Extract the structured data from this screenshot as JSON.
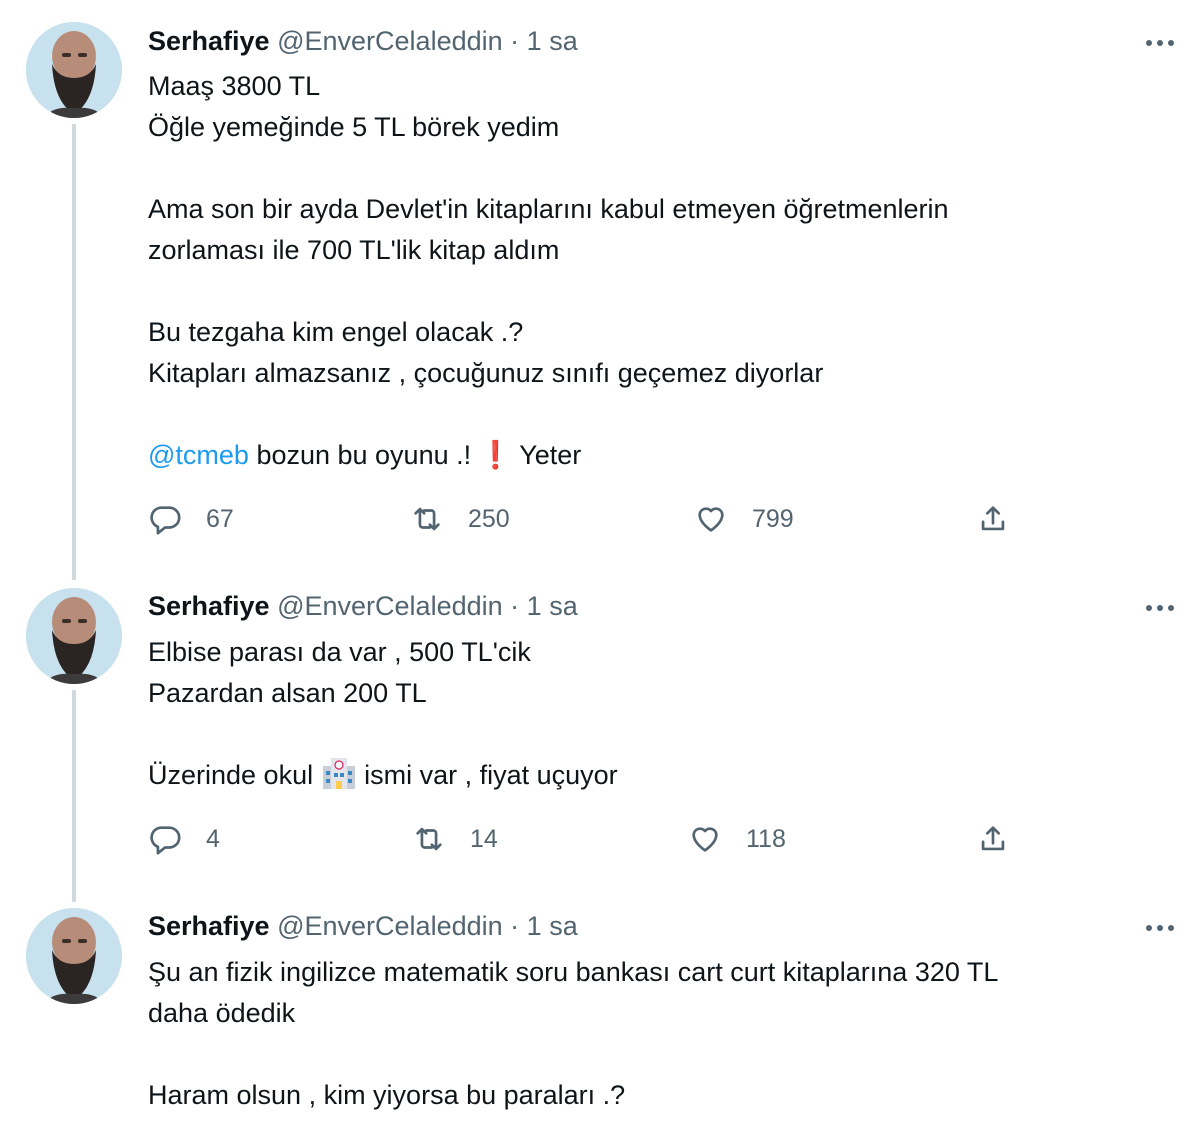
{
  "tweets": [
    {
      "name": "Serhafiye",
      "handle": "@EnverCelaleddin",
      "separator": "·",
      "time": "1 sa",
      "lines": [
        "Maaş 3800 TL",
        "Öğle yemeğinde 5 TL börek yedim",
        "",
        "Ama son bir ayda Devlet'in kitaplarını kabul etmeyen öğretmenlerin",
        "zorlaması ile 700 TL'lik kitap aldım",
        "",
        "Bu tezgaha kim engel olacak .?",
        "Kitapları almazsanız , çocuğunuz sınıfı geçemez diyorlar",
        ""
      ],
      "last_line": {
        "mention": "@tcmeb",
        "text_before_emoji": " bozun bu oyunu .! ",
        "emoji": "❗",
        "text_after_emoji": " Yeter"
      },
      "replies": "67",
      "retweets": "250",
      "likes": "799"
    },
    {
      "name": "Serhafiye",
      "handle": "@EnverCelaleddin",
      "separator": "·",
      "time": "1 sa",
      "lines": [
        "Elbise parası da var , 500 TL'cik",
        "Pazardan alsan 200 TL",
        ""
      ],
      "last_line": {
        "text_before_emoji": "Üzerinde okul ",
        "emoji": "school-emoji",
        "text_after_emoji": " ismi var , fiyat uçuyor"
      },
      "replies": "4",
      "retweets": "14",
      "likes": "118"
    },
    {
      "name": "Serhafiye",
      "handle": "@EnverCelaleddin",
      "separator": "·",
      "time": "1 sa",
      "lines": [
        "Şu an fizik ingilizce matematik soru bankası cart curt kitaplarına 320 TL",
        "daha ödedik",
        "",
        "Haram olsun , kim yiyorsa bu paraları .?"
      ]
    }
  ],
  "icons": {
    "reply": "reply-icon",
    "retweet": "retweet-icon",
    "like": "heart-icon",
    "share": "share-icon",
    "more": "more-icon"
  },
  "colors": {
    "text": "#0f1419",
    "secondary": "#536471",
    "mention": "#1d9bf0",
    "thread_line": "#cfd9de"
  }
}
